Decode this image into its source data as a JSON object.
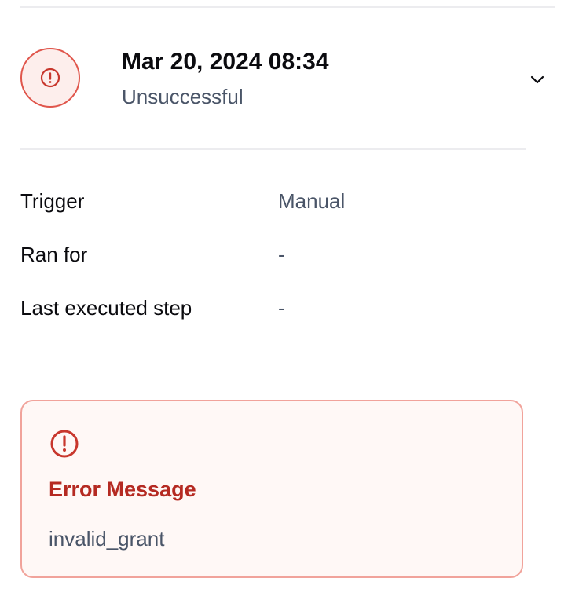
{
  "run": {
    "datetime": "Mar 20, 2024 08:34",
    "status": "Unsuccessful",
    "status_icon": "info-icon",
    "expand_icon": "chevron-down-icon"
  },
  "details": [
    {
      "label": "Trigger",
      "value": "Manual"
    },
    {
      "label": "Ran for",
      "value": "-"
    },
    {
      "label": "Last executed step",
      "value": "-"
    }
  ],
  "error": {
    "icon": "alert-circle-icon",
    "title": "Error Message",
    "message": "invalid_grant"
  },
  "colors": {
    "error_red": "#b52a22",
    "error_border": "#f1a39b",
    "error_bg": "#fff8f6",
    "status_icon_border": "#e0564c",
    "status_icon_bg": "#fdeeec",
    "muted_text": "#4a5568"
  }
}
